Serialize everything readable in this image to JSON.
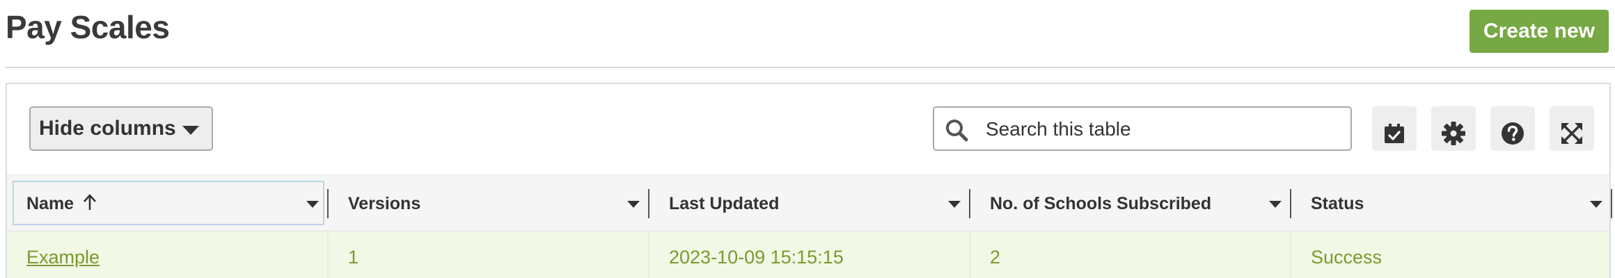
{
  "header": {
    "title": "Pay Scales",
    "create_button": "Create new"
  },
  "toolbar": {
    "hide_columns_label": "Hide columns",
    "search_placeholder": "Search this table",
    "buttons": [
      "select-rows-icon",
      "gear-icon",
      "help-icon",
      "fullscreen-icon"
    ]
  },
  "table": {
    "columns": [
      "Name",
      "Versions",
      "Last Updated",
      "No. of Schools Subscribed",
      "Status"
    ],
    "sort": {
      "column": "Name",
      "direction": "ascending"
    },
    "rows": [
      {
        "name": "Example",
        "versions": "1",
        "last_updated": "2023-10-09 15:15:15",
        "schools_subscribed": "2",
        "status": "Success"
      }
    ]
  },
  "colors": {
    "accent_green": "#76a843",
    "row_text": "#7a9a2e",
    "row_background": "#f1f8e6"
  }
}
